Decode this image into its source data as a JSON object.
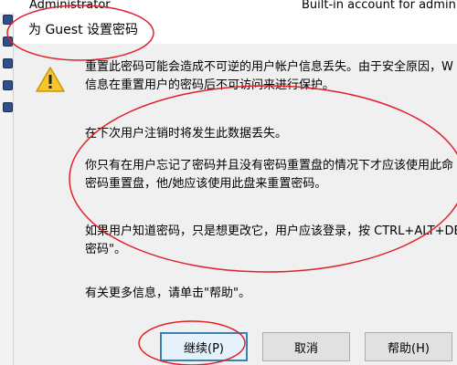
{
  "background_row": {
    "name": "Administrator",
    "description": "Built-in account for admin"
  },
  "dialog": {
    "title": "为 Guest 设置密码",
    "icon": "warning-icon",
    "paragraphs": [
      "重置此密码可能会造成不可逆的用户帐户信息丢失。由于安全原因，W",
      "信息在重置用户的密码后不可访问来进行保护。",
      "在下次用户注销时将发生此数据丢失。",
      "你只有在用户忘记了密码并且没有密码重置盘的情况下才应该使用此命",
      "密码重置盘，他/她应该使用此盘来重置密码。",
      "如果用户知道密码，只是想更改它，用户应该登录，按 CTRL+ALT+DE",
      "密码\"。",
      "有关更多信息，请单击\"帮助\"。"
    ],
    "buttons": {
      "continue": "继续(P)",
      "cancel": "取消",
      "help": "帮助(H)"
    }
  },
  "colors": {
    "annotation": "#e0202a",
    "default_button_border": "#3c7fb1"
  }
}
